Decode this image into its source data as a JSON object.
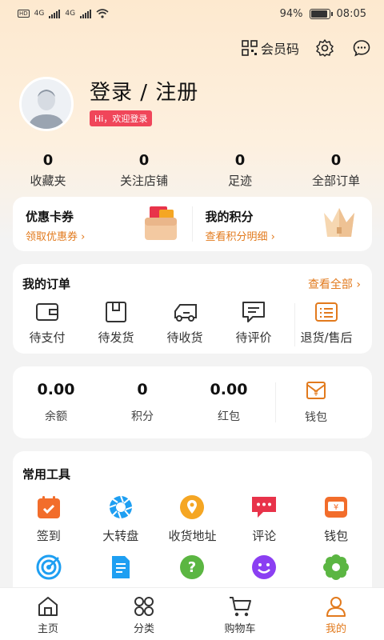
{
  "status_bar": {
    "battery": "94%",
    "battery_level": 0.94,
    "time": "08:05",
    "network": "4G"
  },
  "header": {
    "member_code_label": "会员码"
  },
  "profile": {
    "title": "登录 / 注册",
    "greeting": "Hi，欢迎登录"
  },
  "stats": [
    {
      "num": "0",
      "label": "收藏夹"
    },
    {
      "num": "0",
      "label": "关注店铺"
    },
    {
      "num": "0",
      "label": "足迹"
    },
    {
      "num": "0",
      "label": "全部订单"
    }
  ],
  "promo": {
    "coupon": {
      "title": "优惠卡券",
      "sub": "领取优惠券"
    },
    "points": {
      "title": "我的积分",
      "sub": "查看积分明细"
    }
  },
  "orders": {
    "title": "我的订单",
    "view_all": "查看全部",
    "items": [
      {
        "label": "待支付",
        "icon": "wallet-icon"
      },
      {
        "label": "待发货",
        "icon": "box-icon"
      },
      {
        "label": "待收货",
        "icon": "truck-icon"
      },
      {
        "label": "待评价",
        "icon": "comment-icon"
      },
      {
        "label": "退货/售后",
        "icon": "return-icon"
      }
    ]
  },
  "wallet": {
    "items": [
      {
        "num": "0.00",
        "label": "余额"
      },
      {
        "num": "0",
        "label": "积分"
      },
      {
        "num": "0.00",
        "label": "红包"
      }
    ],
    "purse_label": "钱包"
  },
  "tools": {
    "title": "常用工具",
    "items": [
      {
        "label": "签到",
        "icon": "calendar-icon",
        "color": "#f26d2b"
      },
      {
        "label": "大转盘",
        "icon": "wheel-icon",
        "color": "#1e9ff2"
      },
      {
        "label": "收货地址",
        "icon": "location-icon",
        "color": "#f5a623"
      },
      {
        "label": "评论",
        "icon": "message-icon",
        "color": "#e8334a"
      },
      {
        "label": "钱包",
        "icon": "wallet-icon",
        "color": "#f26d2b"
      },
      {
        "label": "",
        "icon": "target-icon",
        "color": "#1e9ff2"
      },
      {
        "label": "",
        "icon": "document-icon",
        "color": "#1e9ff2"
      },
      {
        "label": "",
        "icon": "help-icon",
        "color": "#5bb642"
      },
      {
        "label": "",
        "icon": "smile-icon",
        "color": "#8b3ff2"
      },
      {
        "label": "",
        "icon": "flower-icon",
        "color": "#5bb642"
      }
    ]
  },
  "tabbar": [
    {
      "label": "主页",
      "icon": "home-icon",
      "active": false
    },
    {
      "label": "分类",
      "icon": "category-icon",
      "active": false
    },
    {
      "label": "购物车",
      "icon": "cart-icon",
      "active": false
    },
    {
      "label": "我的",
      "icon": "user-icon",
      "active": true
    }
  ],
  "colors": {
    "accent": "#e27a1d",
    "badge": "#f0465a"
  }
}
